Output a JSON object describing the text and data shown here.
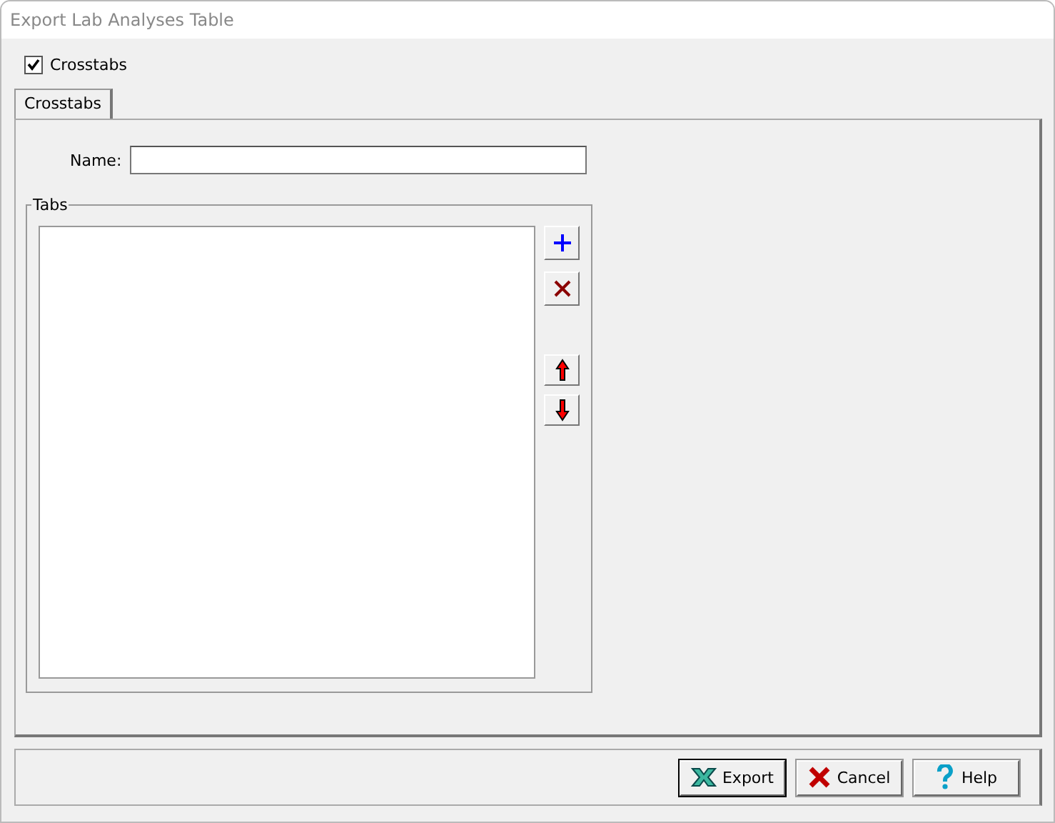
{
  "window": {
    "title": "Export Lab Analyses Table"
  },
  "crosstabs_checkbox": {
    "label": "Crosstabs",
    "checked": true
  },
  "tabs": [
    {
      "label": "Crosstabs",
      "selected": true
    }
  ],
  "name_field": {
    "label": "Name:"
  },
  "tabs_group": {
    "title": "Tabs"
  },
  "side_buttons": [
    {
      "kind": "add"
    },
    {
      "kind": "delete"
    },
    {
      "kind": "up"
    },
    {
      "kind": "down"
    }
  ],
  "buttons": [
    {
      "kind": "export",
      "label": "Export"
    },
    {
      "kind": "cancel",
      "label": "Cancel"
    },
    {
      "kind": "help",
      "label": "Help"
    }
  ]
}
